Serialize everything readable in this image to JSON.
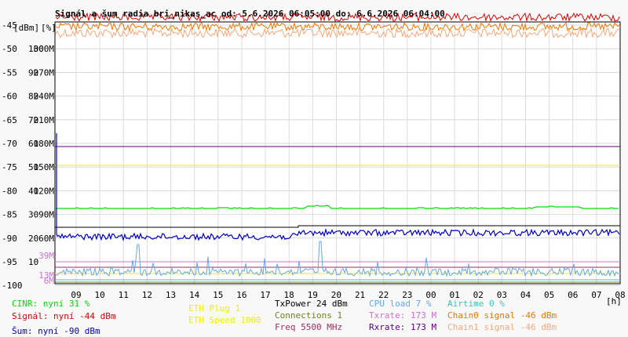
{
  "chart_data": {
    "type": "line",
    "title": "Signál a šum radia bri_nikas_ac od: 5.6.2026 06:05:00 do: 6.6.2026 06:04:00",
    "unit_left": "[dBm]",
    "unit_mid": "[%]",
    "unit_x": "[h]",
    "x_ticks": [
      "09",
      "10",
      "11",
      "12",
      "13",
      "14",
      "15",
      "16",
      "17",
      "18",
      "19",
      "20",
      "21",
      "22",
      "23",
      "00",
      "01",
      "02",
      "03",
      "04",
      "05",
      "06",
      "07",
      "08"
    ],
    "y_left_ticks": [
      "-45",
      "-50",
      "-55",
      "-60",
      "-65",
      "-70",
      "-75",
      "-80",
      "-85",
      "-90",
      "-95",
      "-100"
    ],
    "y_mid_ticks": [
      "100",
      "90",
      "80",
      "70",
      "60",
      "50",
      "40",
      "30",
      "20",
      "10"
    ],
    "y_right_ticks": [
      "300M",
      "270M",
      "240M",
      "210M",
      "180M",
      "150M",
      "120M",
      "90M",
      "60M"
    ],
    "y_right_extra": [
      {
        "label": "39M",
        "value": 39,
        "color": "#d070d0"
      },
      {
        "label": "13M",
        "value": 13,
        "color": "#d070d0"
      },
      {
        "label": "6M",
        "value": 6,
        "color": "#d070d0"
      }
    ],
    "ylim_dbm": [
      -100,
      -45
    ],
    "series": [
      {
        "name": "CINR",
        "color": "#00e000",
        "unit": "%",
        "level": 31
      },
      {
        "name": "Signál",
        "color": "#e00000",
        "unit": "dBm",
        "level": -44
      },
      {
        "name": "Šum",
        "color": "#0000c8",
        "unit": "dBm",
        "level": -90
      },
      {
        "name": "TxPower",
        "color": "#000000",
        "unit": "dBm",
        "level": 24
      },
      {
        "name": "Connections",
        "color": "#708020",
        "level": 1
      },
      {
        "name": "ETH Plug",
        "color": "#f0f000",
        "level": 1
      },
      {
        "name": "ETH Speed",
        "color": "#f0f000",
        "level": 1000
      },
      {
        "name": "Freq",
        "color": "#a03060",
        "unit": "MHz",
        "level": 5500
      },
      {
        "name": "CPU load",
        "color": "#60a8f0",
        "unit": "%",
        "level": 7
      },
      {
        "name": "Txrate",
        "color": "#d070d0",
        "unit": "M",
        "level": 173
      },
      {
        "name": "Rxrate",
        "color": "#600080",
        "unit": "M",
        "level": 173
      },
      {
        "name": "Airtime",
        "color": "#40c0c0",
        "unit": "%",
        "level": 0
      },
      {
        "name": "Chain0 signal",
        "color": "#f07800",
        "unit": "dBm",
        "level": -46
      },
      {
        "name": "Chain1 signal",
        "color": "#f8a878",
        "unit": "dBm",
        "level": -46
      }
    ]
  },
  "legend": {
    "cinr": "CINR: nyní 31 %",
    "signal": "Signál: nyní -44 dBm",
    "sum": "Šum: nyní -90 dBm",
    "eth_plug": "ETH Plug 1",
    "eth_speed": "ETH Speed 1000",
    "txpower": "TxPower 24 dBm",
    "connections": "Connections 1",
    "freq": "Freq 5500 MHz",
    "cpu": "CPU load 7 %",
    "txrate": "Txrate: 173 M",
    "rxrate": "Rxrate: 173 M",
    "airtime": "Airtime 0 %",
    "chain0": "Chain0 signal -46 dBm",
    "chain1": "Chain1 signal -46 dBm"
  }
}
